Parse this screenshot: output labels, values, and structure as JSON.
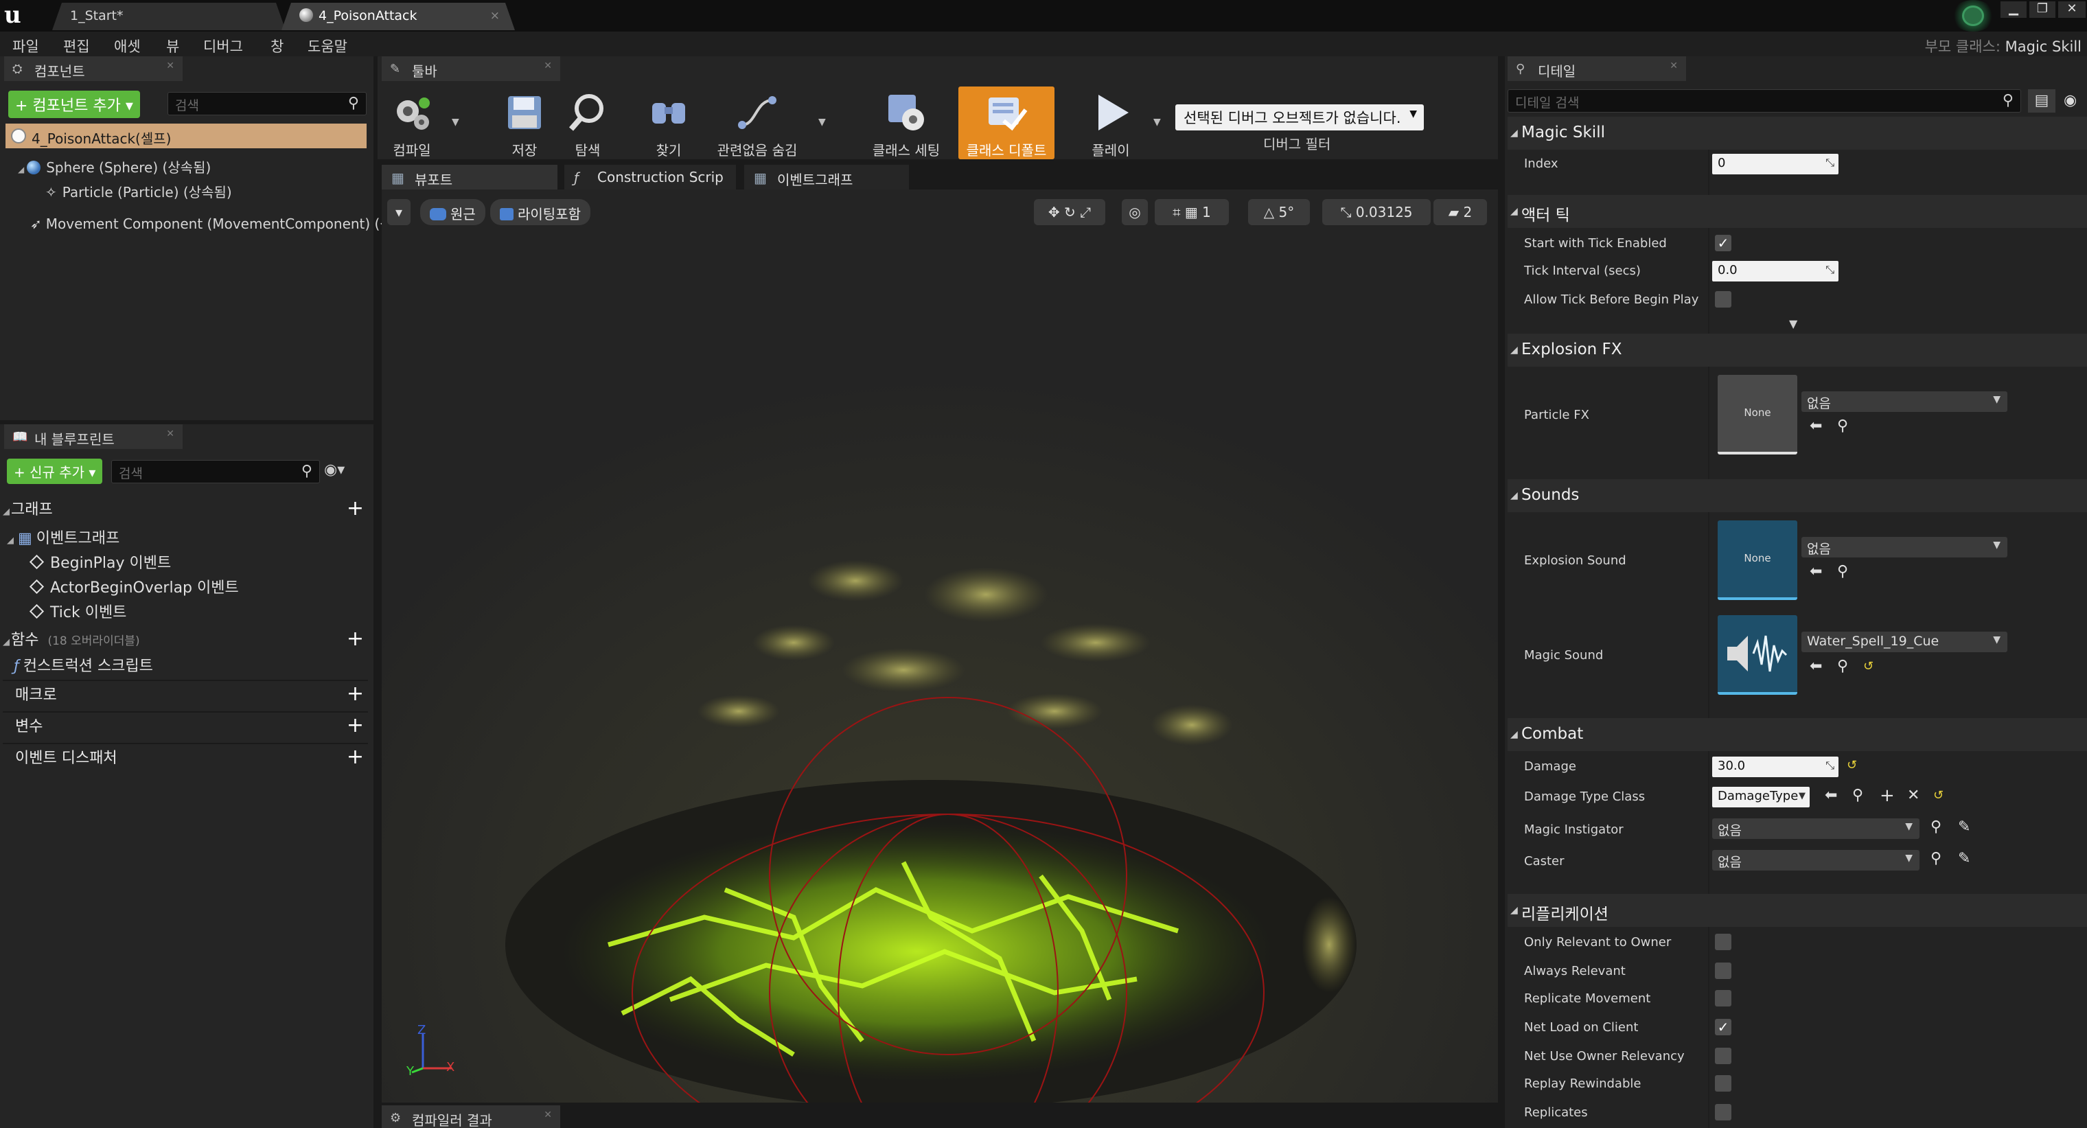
{
  "window": {
    "tabs": [
      {
        "label": "1_Start*"
      },
      {
        "label": "4_PoisonAttack",
        "close": "×"
      }
    ],
    "controls": {
      "minimize": "▁",
      "maximize": "❐",
      "close": "✕"
    }
  },
  "menu": {
    "items": [
      "파일",
      "편집",
      "애셋",
      "뷰",
      "디버그",
      "창",
      "도움말"
    ],
    "parent_class_label": "부모 클래스:",
    "parent_class_value": "Magic Skill"
  },
  "components": {
    "tab": "컴포넌트",
    "add_button": "+ 컴포넌트 추가 ▾",
    "search_placeholder": "검색",
    "root": "4_PoisonAttack(셀프)",
    "tree": [
      "Sphere (Sphere) (상속됨)",
      "Particle (Particle) (상속됨)",
      "Movement Component (MovementComponent) (상속됨)"
    ]
  },
  "blueprint": {
    "tab": "내 블루프린트",
    "add_button": "+ 신규 추가 ▾",
    "search_placeholder": "검색",
    "graphs_header": "그래프",
    "event_graph": "이벤트그래프",
    "events": [
      "BeginPlay 이벤트",
      "ActorBeginOverlap 이벤트",
      "Tick 이벤트"
    ],
    "functions_header": "함수",
    "functions_note": "(18 오버라이더블)",
    "construction_script": "컨스트럭션 스크립트",
    "macros": "매크로",
    "variables": "변수",
    "dispatchers": "이벤트 디스패처"
  },
  "toolbar": {
    "tab": "툴바",
    "buttons": [
      "컴파일",
      "저장",
      "탐색",
      "찾기",
      "관련없음 숨김",
      "클래스 세팅",
      "클래스 디폴트",
      "플레이"
    ],
    "debug_dropdown": "선택된 디버그 오브젝트가 없습니다.",
    "debug_filter": "디버그 필터"
  },
  "editor_tabs": {
    "viewport": "뷰포트",
    "construction": "Construction Scrip",
    "event_graph": "이벤트그래프"
  },
  "viewport": {
    "perspective": "원근",
    "lit": "라이팅포함",
    "snap_angle": "5°",
    "scale_snap": "0.03125",
    "camera_speed": "2",
    "axis_x": "X",
    "axis_y": "Y",
    "axis_z": "Z"
  },
  "compiler": {
    "tab": "컴파일러 결과"
  },
  "details": {
    "tab": "디테일",
    "search_placeholder": "디테일 검색",
    "sections": {
      "magic_skill": "Magic Skill",
      "actor_tick": "액터 틱",
      "explosion_fx": "Explosion FX",
      "sounds": "Sounds",
      "combat": "Combat",
      "replication": "리플리케이션"
    },
    "index_label": "Index",
    "index_value": "0",
    "tick_enabled_label": "Start with Tick Enabled",
    "tick_interval_label": "Tick Interval (secs)",
    "tick_interval_value": "0.0",
    "tick_before_label": "Allow Tick Before Begin Play",
    "particle_fx_label": "Particle FX",
    "particle_fx_thumb": "None",
    "particle_fx_value": "없음",
    "explosion_sound_label": "Explosion Sound",
    "explosion_sound_thumb": "None",
    "explosion_sound_value": "없음",
    "magic_sound_label": "Magic Sound",
    "magic_sound_value": "Water_Spell_19_Cue",
    "damage_label": "Damage",
    "damage_value": "30.0",
    "damage_type_label": "Damage Type Class",
    "damage_type_value": "DamageType",
    "instigator_label": "Magic Instigator",
    "instigator_value": "없음",
    "caster_label": "Caster",
    "caster_value": "없음",
    "replication_rows": [
      {
        "label": "Only Relevant to Owner",
        "checked": false
      },
      {
        "label": "Always Relevant",
        "checked": false
      },
      {
        "label": "Replicate Movement",
        "checked": false
      },
      {
        "label": "Net Load on Client",
        "checked": true
      },
      {
        "label": "Net Use Owner Relevancy",
        "checked": false
      },
      {
        "label": "Replay Rewindable",
        "checked": false
      },
      {
        "label": "Replicates",
        "checked": false
      }
    ]
  }
}
